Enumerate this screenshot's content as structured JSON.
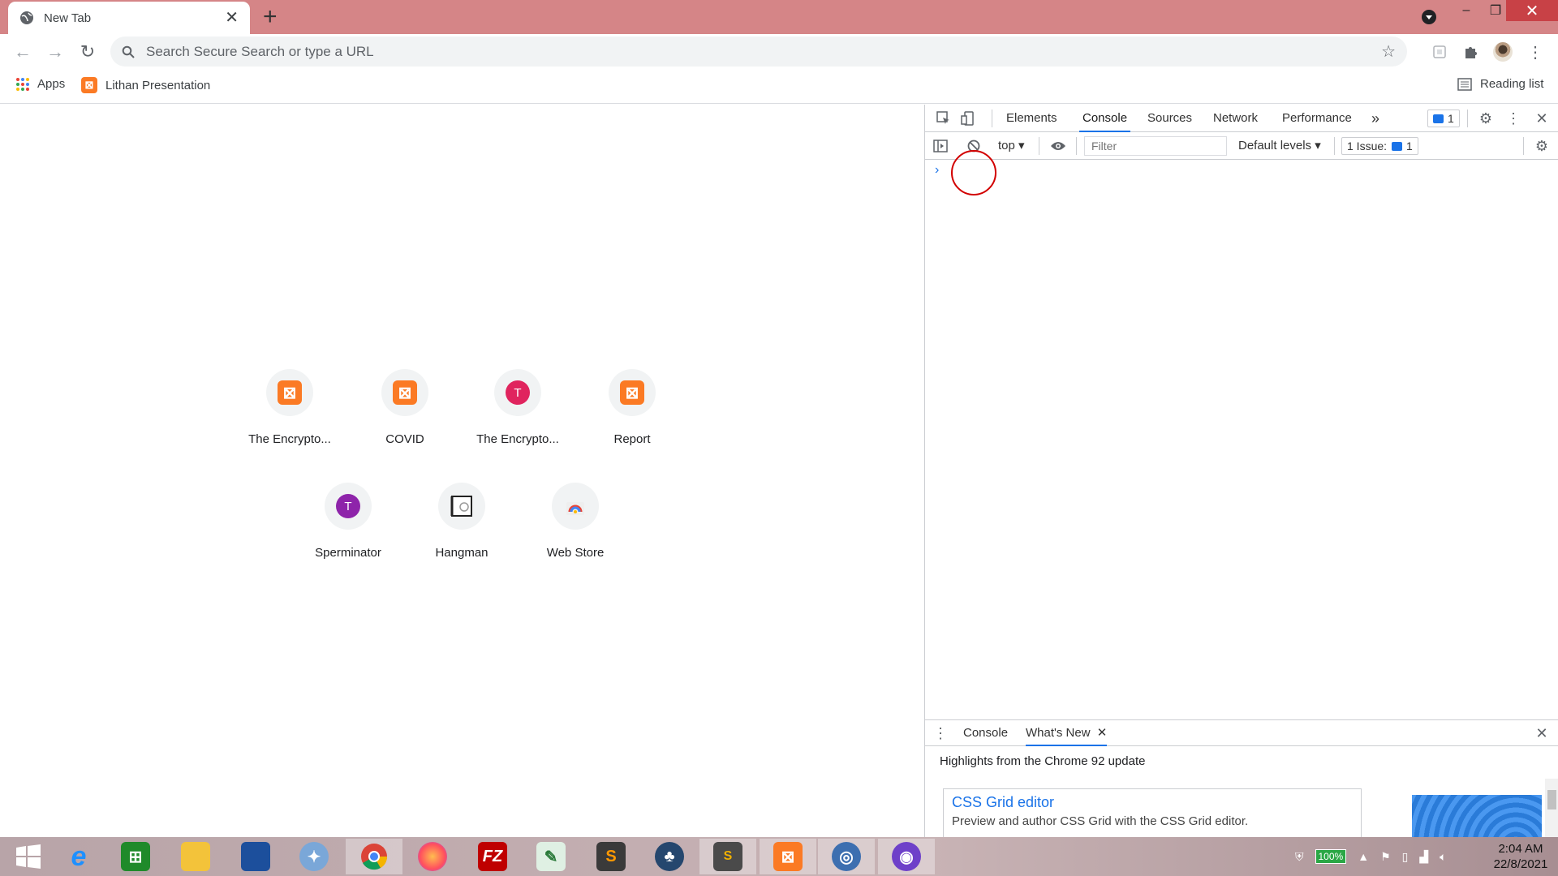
{
  "browser": {
    "tab_title": "New Tab",
    "new_tab_symbol": "+",
    "window_controls": {
      "minimize": "–",
      "maximize": "❐",
      "close": "✕"
    },
    "omnibox_placeholder": "Search Secure Search or type a URL",
    "bookmarks": [
      {
        "label": "Apps",
        "icon": "apps-grid-icon"
      },
      {
        "label": "Lithan Presentation",
        "icon": "xampp-icon"
      }
    ],
    "reading_list": "Reading list"
  },
  "shortcuts": [
    {
      "label": "The Encrypto...",
      "icon": "xampp-icon"
    },
    {
      "label": "COVID",
      "icon": "xampp-icon"
    },
    {
      "label": "The Encrypto...",
      "icon": "letter-t-icon",
      "letter": "T",
      "color": "#e0245e"
    },
    {
      "label": "Report",
      "icon": "xampp-icon"
    },
    {
      "label": "Sperminator",
      "icon": "letter-t-icon",
      "letter": "T",
      "color": "#8e24aa"
    },
    {
      "label": "Hangman",
      "icon": "hangman-icon"
    },
    {
      "label": "Web Store",
      "icon": "web-store-icon"
    }
  ],
  "devtools": {
    "tabs": [
      "Elements",
      "Console",
      "Sources",
      "Network",
      "Performance"
    ],
    "active_tab": "Console",
    "more_tabs": "»",
    "issues_badge": "1",
    "context": "top",
    "filter_placeholder": "Filter",
    "levels": "Default levels",
    "issues_label": "1 Issue:",
    "issues_count": "1",
    "prompt": "›",
    "drawer": {
      "tabs": [
        "Console",
        "What's New"
      ],
      "active_tab": "What's New",
      "highlights": "Highlights from the Chrome 92 update",
      "card_title": "CSS Grid editor",
      "card_desc": "Preview and author CSS Grid with the CSS Grid editor."
    }
  },
  "taskbar": {
    "apps": [
      "start",
      "internet-explorer",
      "store",
      "file-explorer",
      "remote-desktop",
      "safari",
      "chrome",
      "firefox",
      "filezilla",
      "notepad-feather",
      "sublime-text",
      "app-tree",
      "terminal-s",
      "xampp",
      "disk-util",
      "github"
    ],
    "active_app": "chrome",
    "battery": "100%",
    "time": "2:04 AM",
    "date": "22/8/2021"
  },
  "colors": {
    "titlebar": "#d58587",
    "accent": "#1a73e8",
    "xampp_orange": "#fb7a24",
    "highlight_circle": "#d20000"
  }
}
